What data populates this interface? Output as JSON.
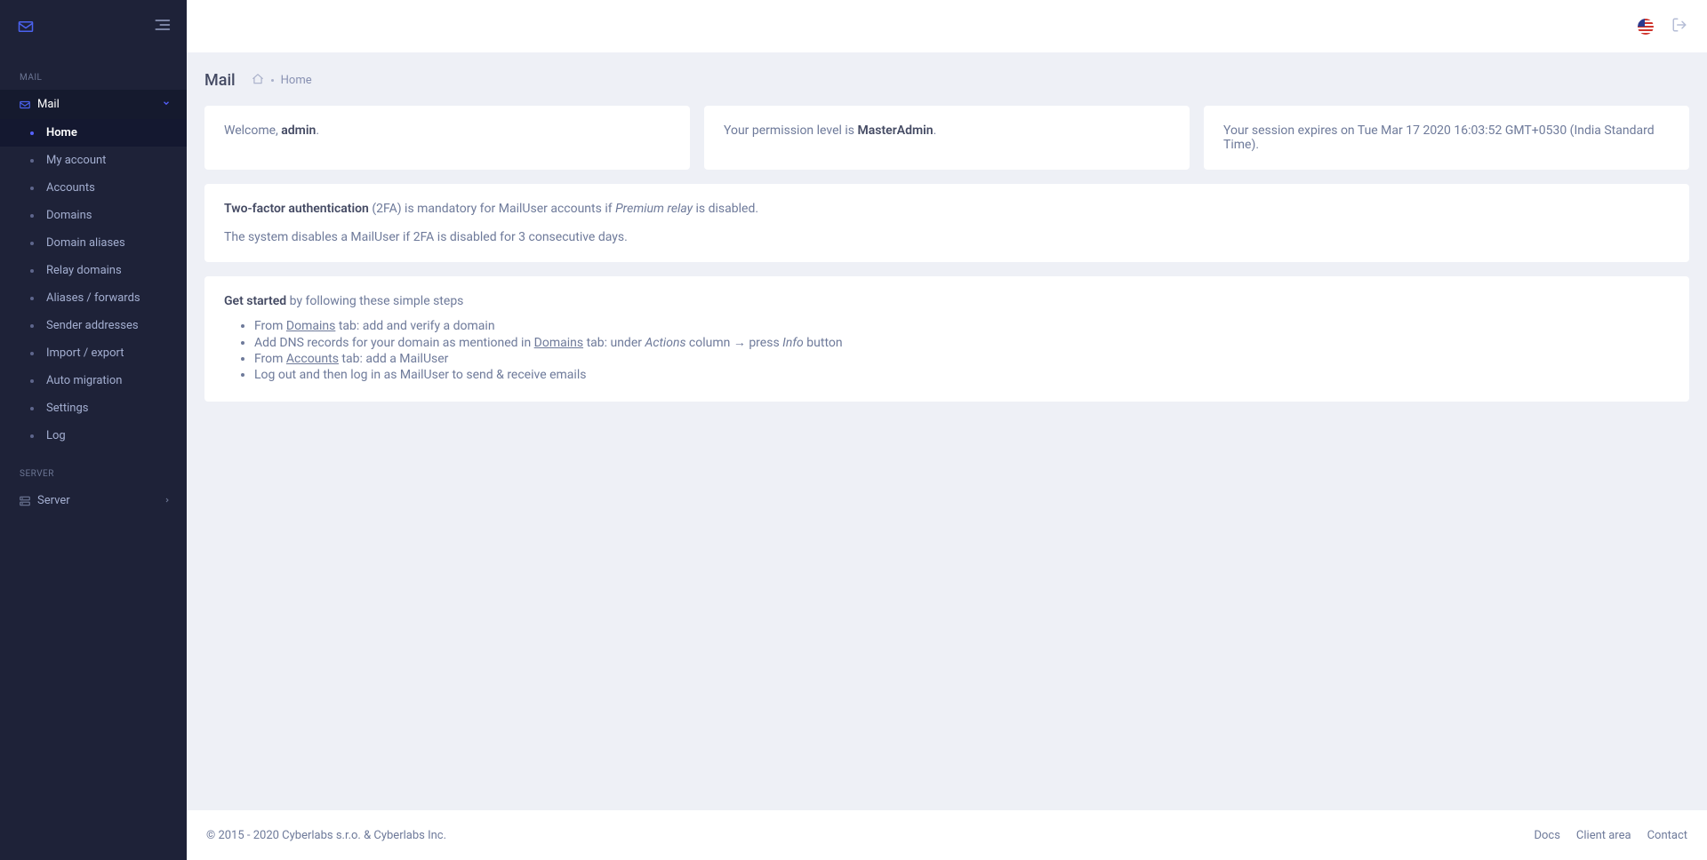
{
  "sidebar": {
    "sections": {
      "mail_label": "MAIL",
      "server_label": "SERVER"
    },
    "mail_item": {
      "label": "Mail"
    },
    "server_item": {
      "label": "Server"
    },
    "sub": {
      "home": "Home",
      "my_account": "My account",
      "accounts": "Accounts",
      "domains": "Domains",
      "domain_aliases": "Domain aliases",
      "relay_domains": "Relay domains",
      "aliases_forwards": "Aliases / forwards",
      "sender_addresses": "Sender addresses",
      "import_export": "Import / export",
      "auto_migration": "Auto migration",
      "settings": "Settings",
      "log": "Log"
    }
  },
  "header": {
    "title": "Mail",
    "breadcrumb_current": "Home"
  },
  "cards": {
    "welcome_prefix": "Welcome, ",
    "welcome_user": "admin",
    "welcome_suffix": ".",
    "perm_prefix": "Your permission level is ",
    "perm_level": "MasterAdmin",
    "perm_suffix": ".",
    "session_text": "Your session expires on Tue Mar 17 2020 16:03:52 GMT+0530 (India Standard Time)."
  },
  "twofa": {
    "bold": "Two-factor authentication",
    "mid1": " (2FA) is mandatory for MailUser accounts if ",
    "em": "Premium relay",
    "mid2": " is disabled.",
    "line2": "The system disables a MailUser if 2FA is disabled for 3 consecutive days."
  },
  "getstarted": {
    "bold": "Get started",
    "rest": " by following these simple steps",
    "step1_a": "From ",
    "step1_link": "Domains",
    "step1_b": " tab: add and verify a domain",
    "step2_a": "Add DNS records for your domain as mentioned in ",
    "step2_link": "Domains",
    "step2_b": " tab: under ",
    "step2_em1": "Actions",
    "step2_c": " column → press ",
    "step2_em2": "Info",
    "step2_d": " button",
    "step3_a": "From ",
    "step3_link": "Accounts",
    "step3_b": " tab: add a MailUser",
    "step4": "Log out and then log in as MailUser to send & receive emails"
  },
  "footer": {
    "copyright": "© 2015 - 2020 Cyberlabs s.r.o. & Cyberlabs Inc.",
    "links": {
      "docs": "Docs",
      "client_area": "Client area",
      "contact": "Contact"
    }
  }
}
